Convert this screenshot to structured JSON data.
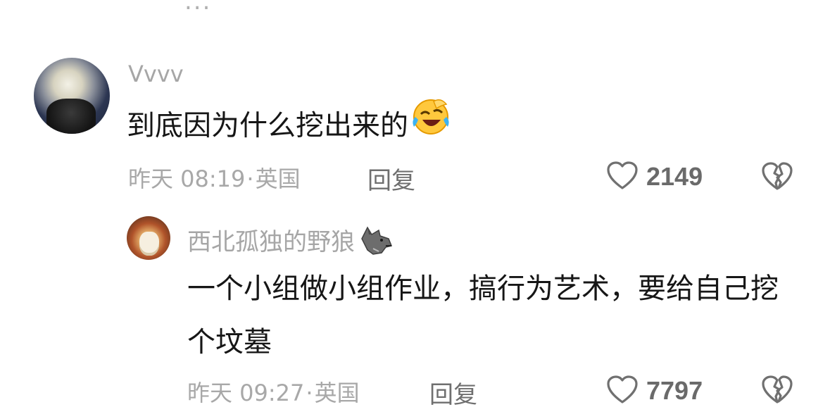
{
  "top_fragment": "...",
  "comments": [
    {
      "username": "Vvvv",
      "text": "到底因为什么挖出来的",
      "emoji": "face-with-tears-of-joy",
      "date": "昨天 08:19",
      "location": "英国",
      "reply_label": "回复",
      "likes": "2149"
    }
  ],
  "replies": [
    {
      "username": "西北孤独的野狼",
      "username_emoji": "wolf",
      "text": "一个小组做小组作业，搞行为艺术，要给自己挖个坟墓",
      "date": "昨天 09:27",
      "location": "英国",
      "reply_label": "回复",
      "likes": "7797"
    }
  ],
  "meta_separator": "·",
  "icons": {
    "like": "heart-outline-icon",
    "dislike": "broken-heart-icon"
  },
  "colors": {
    "text_primary": "#161616",
    "text_secondary": "#a8a8a8",
    "icon_gray": "#707070"
  }
}
